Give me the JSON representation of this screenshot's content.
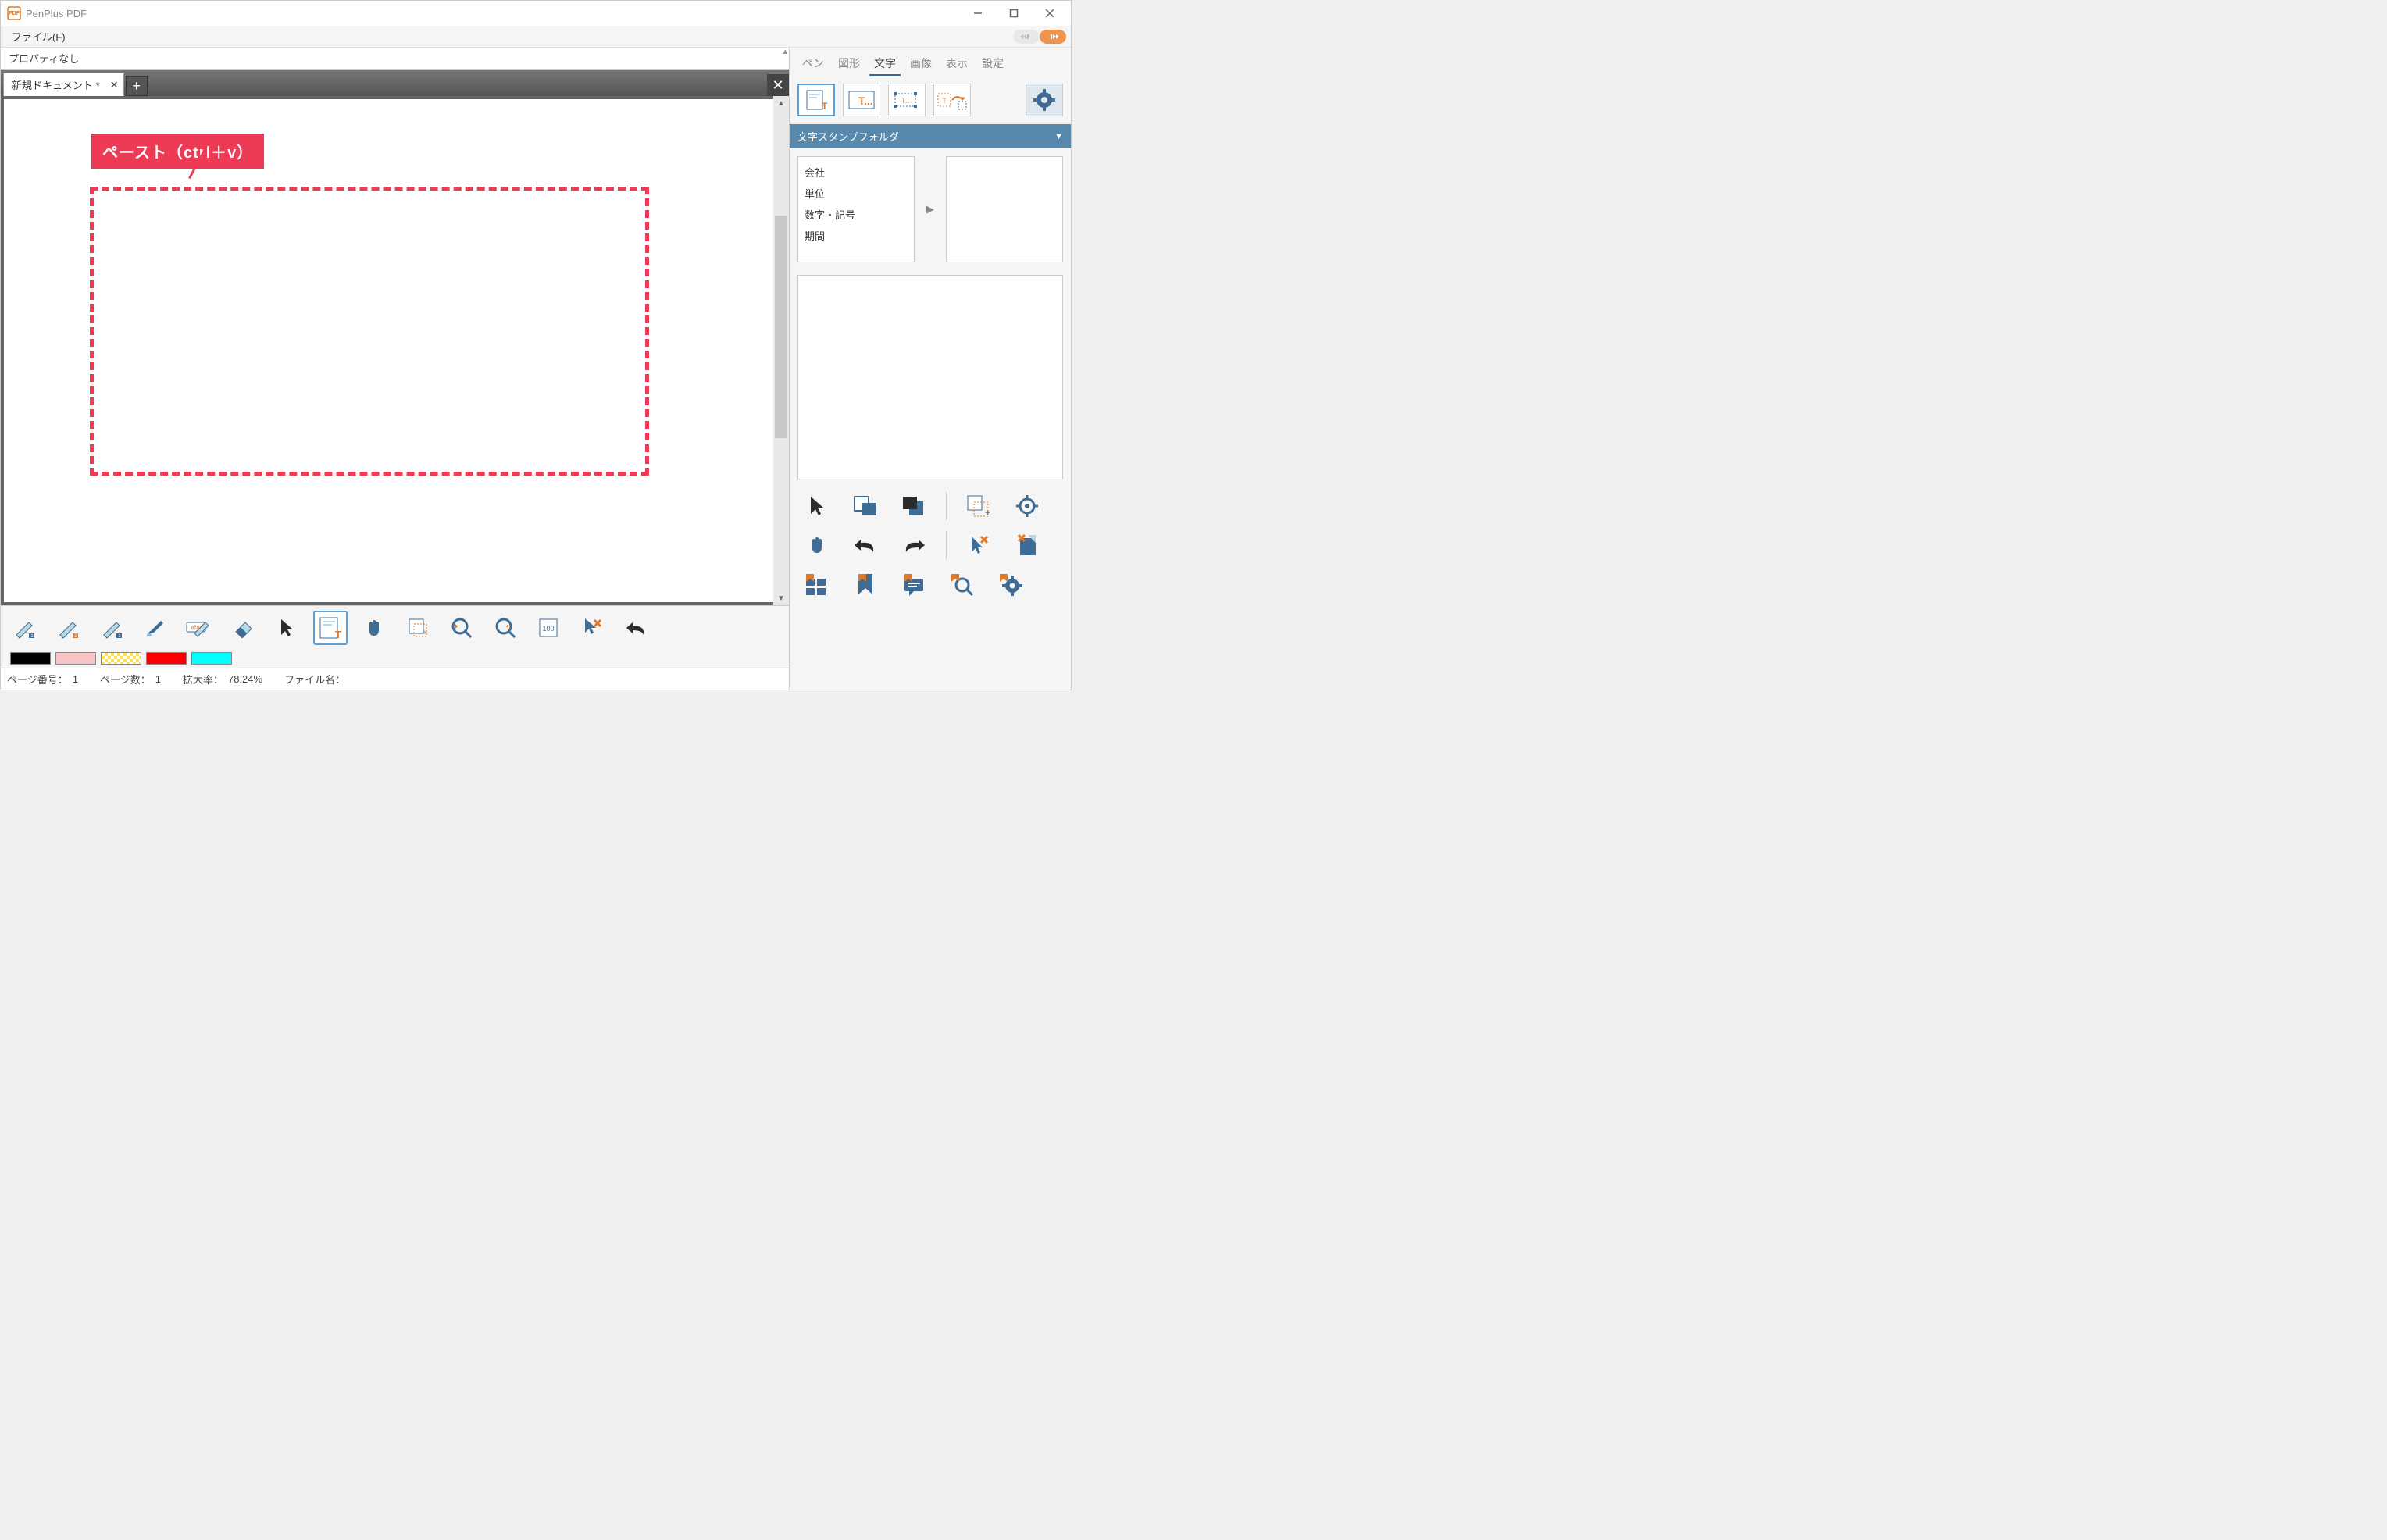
{
  "title": "PenPlus PDF",
  "menu": {
    "file": "ファイル(F)"
  },
  "properties": {
    "none": "プロパティなし"
  },
  "tab": {
    "name": "新規ドキュメント *"
  },
  "callout": {
    "text": "ペースト（ctrl＋v）"
  },
  "palette": [
    "#000000",
    "#f6c4c4",
    "checker",
    "#ff0000",
    "#00ffff"
  ],
  "status": {
    "page_no_label": "ページ番号：",
    "page_no": "1",
    "page_count_label": "ページ数：",
    "page_count": "1",
    "zoom_label": "拡大率：",
    "zoom": "78.24%",
    "filename_label": "ファイル名："
  },
  "right": {
    "tabs": [
      "ペン",
      "図形",
      "文字",
      "画像",
      "表示",
      "設定"
    ],
    "active_tab": 2,
    "section_header": "文字スタンプフォルダ",
    "stamp_folders": [
      "会社",
      "単位",
      "数字・記号",
      "期間"
    ]
  }
}
